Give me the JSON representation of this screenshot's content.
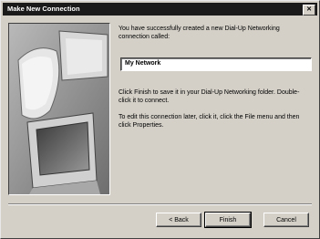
{
  "window": {
    "title": "Make New Connection"
  },
  "dialog": {
    "intro_text": "You have successfully created a new Dial-Up Networking connection called:",
    "connection_name": "My Network",
    "finish_text": "Click Finish to save it in your Dial-Up Networking folder. Double-click it to connect.",
    "edit_text": "To edit this connection later, click it, click the File menu and then click Properties."
  },
  "buttons": {
    "back": "< Back",
    "finish": "Finish",
    "cancel": "Cancel"
  },
  "icons": {
    "close": "close-icon",
    "illustration": "computer-monitor-illustration"
  }
}
